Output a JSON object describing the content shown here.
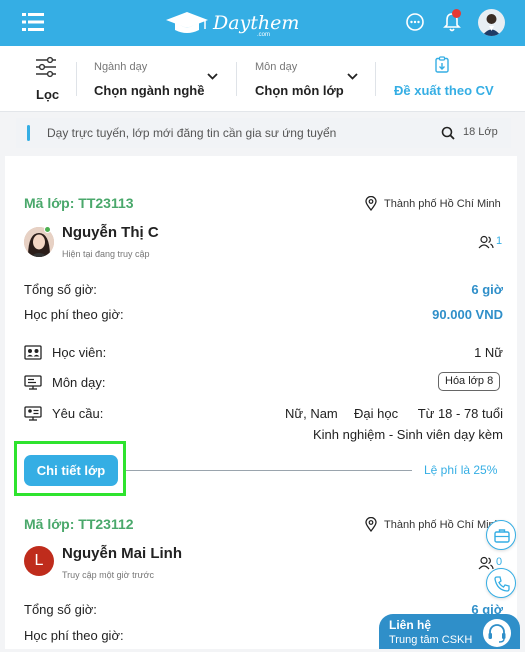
{
  "app": {
    "brand": "Daythem",
    "brand_sub": ".com"
  },
  "filters": {
    "filter_label": "Lọc",
    "major": {
      "label": "Ngành dạy",
      "value": "Chọn ngành nghề"
    },
    "subject": {
      "label": "Môn dạy",
      "value": "Chọn môn lớp"
    },
    "suggest": "Đề xuất theo CV"
  },
  "info": {
    "text": "Dạy trực tuyến, lớp mới đăng tin cần gia sư ứng tuyển",
    "count": "18 Lớp"
  },
  "classes": [
    {
      "code": "Mã lớp: TT23113",
      "city": "Thành phố Hồ Chí Minh",
      "name": "Nguyễn Thị C",
      "status": "Hiện tại đang truy cập",
      "applicants": "1",
      "total_hours_label": "Tổng số giờ:",
      "total_hours": "6 giờ",
      "fee_label": "Học phí theo giờ:",
      "fee": "90.000 VND",
      "student_label": "Học viên:",
      "student": "1 Nữ",
      "subject_label": "Môn dạy:",
      "subject": "Hóa lớp 8",
      "req_label": "Yêu cầu:",
      "req_gender": "Nữ, Nam",
      "req_level": "Đại học",
      "req_age": "Từ 18 - 78 tuổi",
      "req_experience": "Kinh nghiệm - Sinh viên dạy kèm",
      "detail_button": "Chi tiết lớp",
      "fee_rate": "Lệ phí là 25%"
    },
    {
      "code": "Mã lớp: TT23112",
      "city": "Thành phố Hồ Chí Minh",
      "name": "Nguyễn Mai Linh",
      "avatar_letter": "L",
      "status": "Truy cập một giờ trước",
      "applicants": "0",
      "total_hours_label": "Tổng số giờ:",
      "total_hours": "6 giờ",
      "fee_label": "Học phí theo giờ:"
    }
  ],
  "contact": {
    "title": "Liên hệ",
    "subtitle": "Trung tâm CSKH"
  },
  "colors": {
    "primary": "#35aee4",
    "code_green": "#4aa86b",
    "highlight": "#2ee32e"
  }
}
